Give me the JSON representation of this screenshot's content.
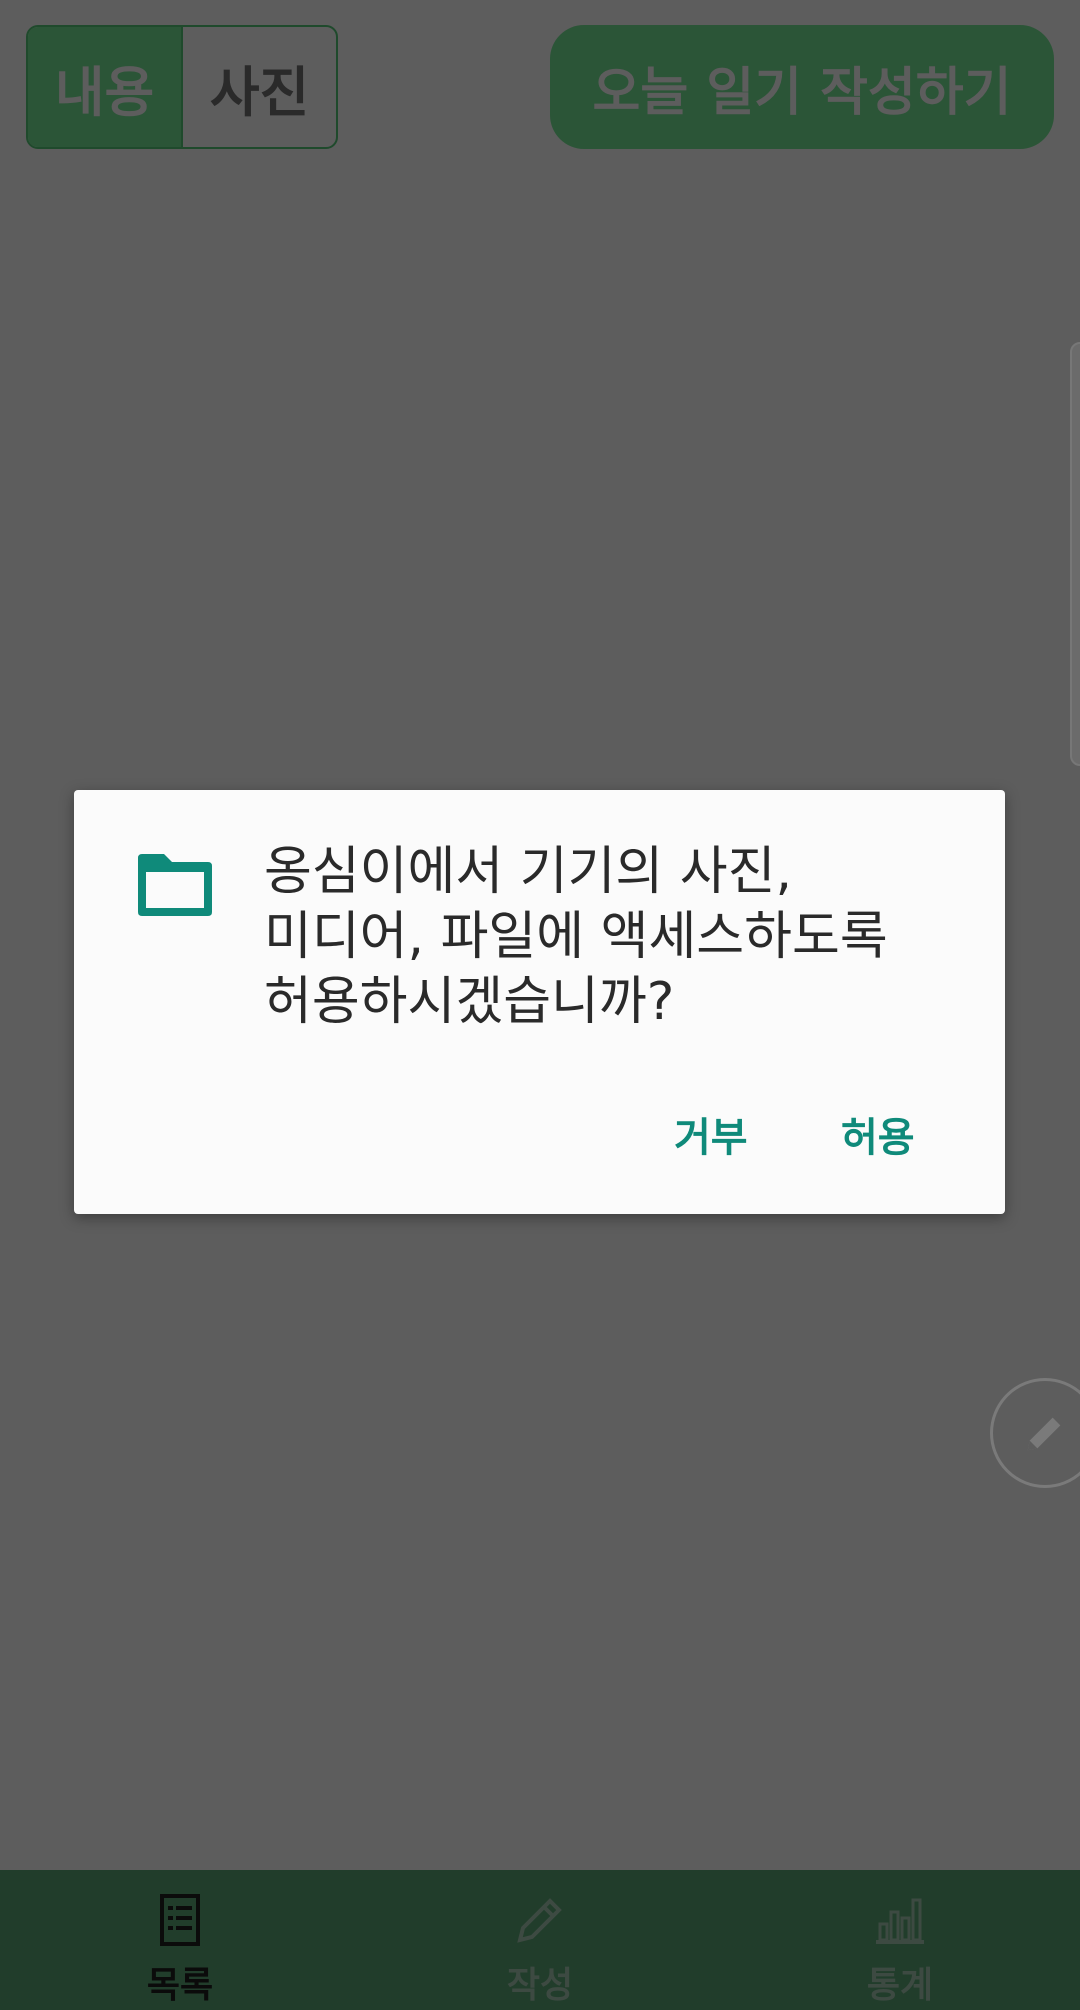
{
  "header": {
    "toggle": {
      "left_label": "내용",
      "right_label": "사진"
    },
    "write_today_label": "오늘 일기 작성하기"
  },
  "dialog": {
    "icon": "folder-icon",
    "message_lines": [
      "옹심이에서 기기의 사진,",
      "미디어, 파일에 액세스하도록",
      "허용하시겠습니까?"
    ],
    "deny_label": "거부",
    "allow_label": "허용",
    "accent_color": "#0f8a7a"
  },
  "fab": {
    "icon": "pencil-icon"
  },
  "bottom_nav": {
    "items": [
      {
        "label": "목록",
        "icon": "list-icon",
        "active": true
      },
      {
        "label": "작성",
        "icon": "pencil-icon",
        "active": false
      },
      {
        "label": "통계",
        "icon": "bar-chart-icon",
        "active": false
      }
    ]
  },
  "colors": {
    "overlay_bg": "#5d5d5d",
    "primary_green": "#2b5537",
    "nav_bg": "#213d2b"
  }
}
